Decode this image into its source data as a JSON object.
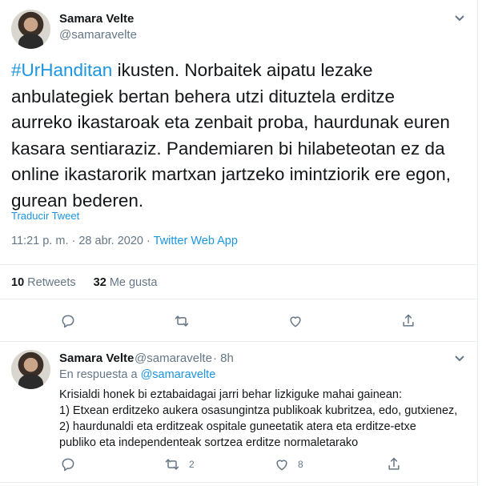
{
  "tweet": {
    "author_name": "Samara Velte",
    "author_handle": "@samaravelte",
    "hashtag": "#UrHanditan",
    "body": " ikusten. Norbaitek aipatu lezake anbulategiek bertan behera utzi dituztela erditze aurreko ikastaroak eta zenbait proba, haurdunak euren kasara sentiaraziz. Pandemiaren bi hilabeteotan ez da online ikastarorik martxan jartzeko imintziorik ere egon, gurean bederen.",
    "translate_label": "Traducir Tweet",
    "time": "11:21 p. m.",
    "date": "28 abr. 2020",
    "separator": " · ",
    "app": "Twitter Web App",
    "retweets_count": "10",
    "retweets_label": " Retweets",
    "likes_count": "32",
    "likes_label": " Me gusta"
  },
  "reply": {
    "author_name": "Samara Velte",
    "author_handle": "@samaravelte",
    "time_ago": "· 8h",
    "reply_prefix": "En respuesta a ",
    "reply_handle": "@samaravelte",
    "line1": "Krisialdi honek bi eztabaidagai jarri behar lizkiguke mahai gainean:",
    "line2": "1) Etxean erditzeko aukera osasungintza publikoak kubritzea, edo, gutxienez,",
    "line3": "2) haurdunaldi eta erditzeak ospitale guneetatik atera eta erditze-etxe",
    "line4": "publiko eta independenteak sortzea erditze normaletarako",
    "retweet_count": "2",
    "like_count": "8"
  },
  "icons": [
    "caret-down-icon",
    "reply-icon",
    "retweet-icon",
    "like-icon",
    "share-icon"
  ],
  "colors": {
    "link": "#1b95e0",
    "muted": "#657786",
    "text": "#14171a",
    "border": "#e6ecf0"
  }
}
